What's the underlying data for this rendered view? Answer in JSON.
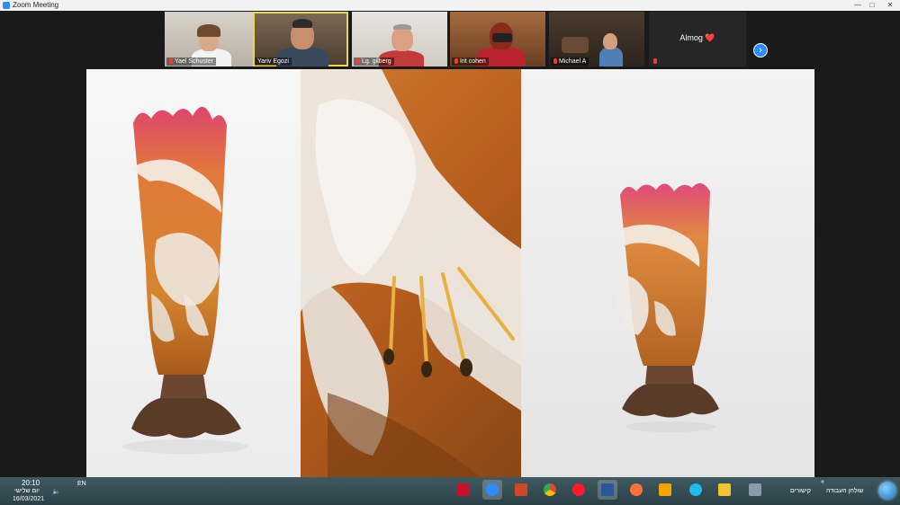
{
  "window": {
    "title": "Zoom Meeting",
    "minimize": "—",
    "maximize": "□",
    "close": "✕"
  },
  "participants": [
    {
      "name": "Yael Schuster"
    },
    {
      "name": "Yariv Egozi"
    },
    {
      "name": "Lg. gilberg"
    },
    {
      "name": "Irit cohen"
    },
    {
      "name": "Michael A"
    },
    {
      "name": "Almog ❤️"
    }
  ],
  "gallery_next": "›",
  "taskbar": {
    "time": "20:10",
    "day": "יום שלישי",
    "date": "16/03/2021",
    "lang": "EN",
    "volume": "🔈",
    "links": "קישורים",
    "desktop": "שולחן העבודה",
    "chevron": "«"
  },
  "colors": {
    "accent": "#2d8cff",
    "active_speaker": "#e9d94a",
    "taskbar": "#3a5459"
  }
}
